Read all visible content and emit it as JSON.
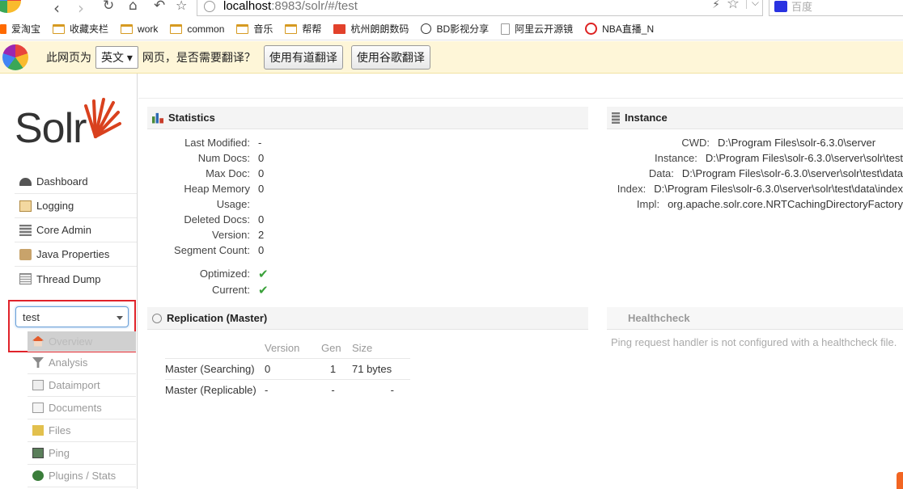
{
  "browser": {
    "url_host": "localhost",
    "url_rest": ":8983/solr/#/test",
    "search_placeholder": "百度",
    "bookmarks": [
      "爱淘宝",
      "收藏夹栏",
      "work",
      "common",
      "音乐",
      "帮帮",
      "杭州朗朗数码",
      "BD影视分享",
      "阿里云开源镜",
      "NBA直播_N"
    ]
  },
  "translate_bar": {
    "prefix": "此网页为",
    "language": "英文",
    "suffix": "网页，是否需要翻译？",
    "btn_youdao": "使用有道翻译",
    "btn_google": "使用谷歌翻译"
  },
  "sidebar": {
    "logo_text": "Solr",
    "nav": [
      "Dashboard",
      "Logging",
      "Core Admin",
      "Java Properties",
      "Thread Dump"
    ],
    "core_selected": "test",
    "core_nav": [
      "Overview",
      "Analysis",
      "Dataimport",
      "Documents",
      "Files",
      "Ping",
      "Plugins / Stats"
    ]
  },
  "statistics": {
    "title": "Statistics",
    "rows": [
      {
        "key": "Last Modified:",
        "value": "-"
      },
      {
        "key": "Num Docs:",
        "value": "0"
      },
      {
        "key": "Max Doc:",
        "value": "0"
      },
      {
        "key": "Heap Memory",
        "value": "0"
      },
      {
        "key": "Usage:",
        "value": ""
      },
      {
        "key": "Deleted Docs:",
        "value": "0"
      },
      {
        "key": "Version:",
        "value": "2"
      },
      {
        "key": "Segment Count:",
        "value": "0"
      }
    ],
    "optimized_label": "Optimized:",
    "current_label": "Current:"
  },
  "instance": {
    "title": "Instance",
    "rows": [
      {
        "key": "CWD:",
        "value": "D:\\Program Files\\solr-6.3.0\\server"
      },
      {
        "key": "Instance:",
        "value": "D:\\Program Files\\solr-6.3.0\\server\\solr\\test"
      },
      {
        "key": "Data:",
        "value": "D:\\Program Files\\solr-6.3.0\\server\\solr\\test\\data"
      },
      {
        "key": "Index:",
        "value": "D:\\Program Files\\solr-6.3.0\\server\\solr\\test\\data\\index"
      },
      {
        "key": "Impl:",
        "value": "org.apache.solr.core.NRTCachingDirectoryFactory"
      }
    ]
  },
  "replication": {
    "title": "Replication (Master)",
    "columns": [
      "",
      "Version",
      "Gen",
      "Size"
    ],
    "rows": [
      [
        "Master (Searching)",
        "0",
        "1",
        "71 bytes"
      ],
      [
        "Master (Replicable)",
        "-",
        "-",
        "-"
      ]
    ]
  },
  "healthcheck": {
    "title": "Healthcheck",
    "message": "Ping request handler is not configured with a healthcheck file."
  }
}
